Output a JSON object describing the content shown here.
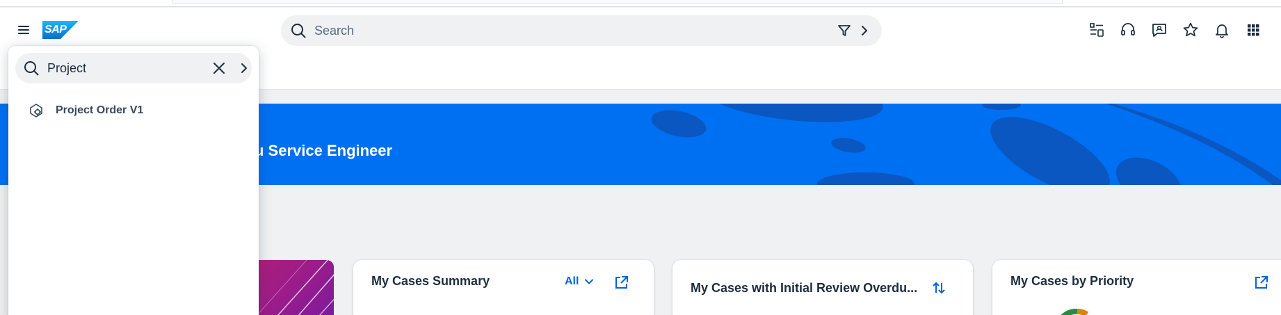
{
  "shell": {
    "logo_text": "SAP",
    "search_placeholder": "Search",
    "icons": [
      "menu-icon",
      "search-icon",
      "filter-icon",
      "chevron-right-icon",
      "app-switcher-list-icon",
      "headset-icon",
      "chat-feedback-icon",
      "star-icon",
      "bell-icon",
      "grid-icon"
    ]
  },
  "banner": {
    "title": "u Service Engineer"
  },
  "cards": [
    {
      "title": "My Cases Summary",
      "filter_label": "All"
    },
    {
      "title": "My Cases with Initial Review Overdu..."
    },
    {
      "title": "My Cases by Priority"
    }
  ],
  "search_panel": {
    "query": "Project",
    "results": [
      {
        "label": "Project Order V1",
        "icon": "tile-gear-icon"
      }
    ]
  },
  "colors": {
    "brand_blue": "#0070f2",
    "link_blue": "#0064d9",
    "text": "#1d2d3e",
    "background": "#eff1f2"
  }
}
